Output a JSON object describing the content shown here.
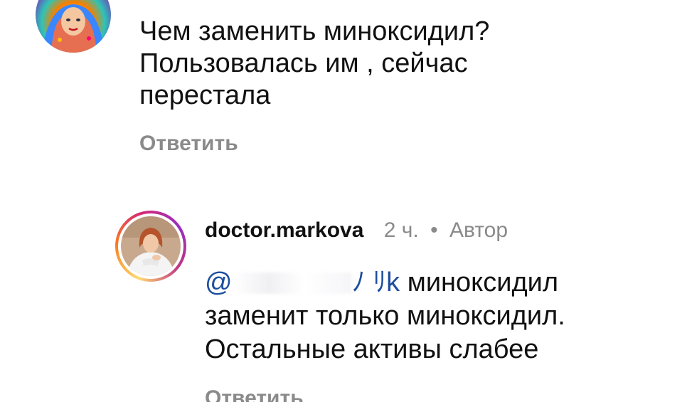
{
  "top_comment": {
    "text": "Чем заменить миноксидил?\nПользовалась им , сейчас\nперестала",
    "reply_label": "Ответить"
  },
  "reply_comment": {
    "username": "doctor.markova",
    "time": "2 ч.",
    "separator": "•",
    "author_badge": "Автор",
    "mention_prefix": "@",
    "mention_suffix": "ﾉ ﾘk",
    "text": " миноксидил заменит только миноксидил. Остальные активы слабее",
    "reply_label": "Ответить"
  },
  "colors": {
    "text": "#111111",
    "secondary": "#8a8a8a",
    "mention": "#1d4e9e"
  },
  "icons": {
    "top_avatar": "illustrated-woman-avatar",
    "reply_avatar": "doctor-photo-avatar-with-story-ring"
  }
}
